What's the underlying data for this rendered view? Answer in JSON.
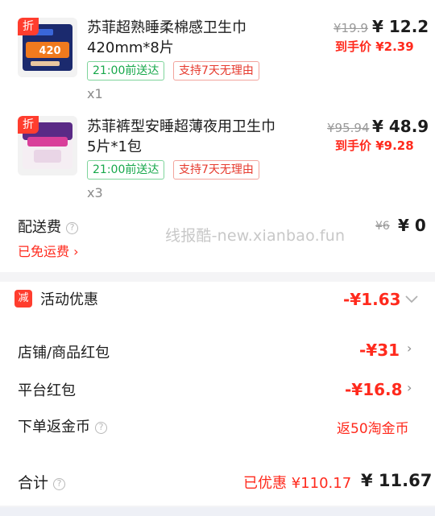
{
  "items": [
    {
      "badge": "折",
      "title_line1": "苏菲超熟睡柔棉感卫生巾",
      "title_line2": "420mm*8片",
      "chip_delivery": "21:00前送达",
      "chip_return": "支持7天无理由",
      "qty": "x1",
      "original_price": "¥19.9",
      "price": "¥ 12.2",
      "final_label": "到手价 ¥2.39",
      "pkg_text": "420"
    },
    {
      "badge": "折",
      "title_line1": "苏菲裤型安睡超薄夜用卫生巾",
      "title_line2": "5片*1包",
      "chip_delivery": "21:00前送达",
      "chip_return": "支持7天无理由",
      "qty": "x3",
      "original_price": "¥95.94",
      "price": "¥ 48.9",
      "final_label": "到手价 ¥9.28"
    }
  ],
  "shipping": {
    "label": "配送费",
    "free_text": "已免运费",
    "original": "¥6",
    "amount": "¥ 0"
  },
  "watermark": "线报酷-new.xianbao.fun",
  "promo": {
    "badge": "减",
    "label": "活动优惠",
    "amount": "-¥1.63"
  },
  "store_coupon": {
    "label": "店铺/商品红包",
    "amount": "-¥31"
  },
  "platform_coupon": {
    "label": "平台红包",
    "amount": "-¥16.8"
  },
  "coins": {
    "label": "下单返金币",
    "value": "返50淘金币"
  },
  "total": {
    "label": "合计",
    "saved": "已优惠 ¥110.17",
    "amount": "¥ 11.67"
  },
  "colors": {
    "accent_red": "#ff2a1d",
    "green": "#17a84b"
  }
}
